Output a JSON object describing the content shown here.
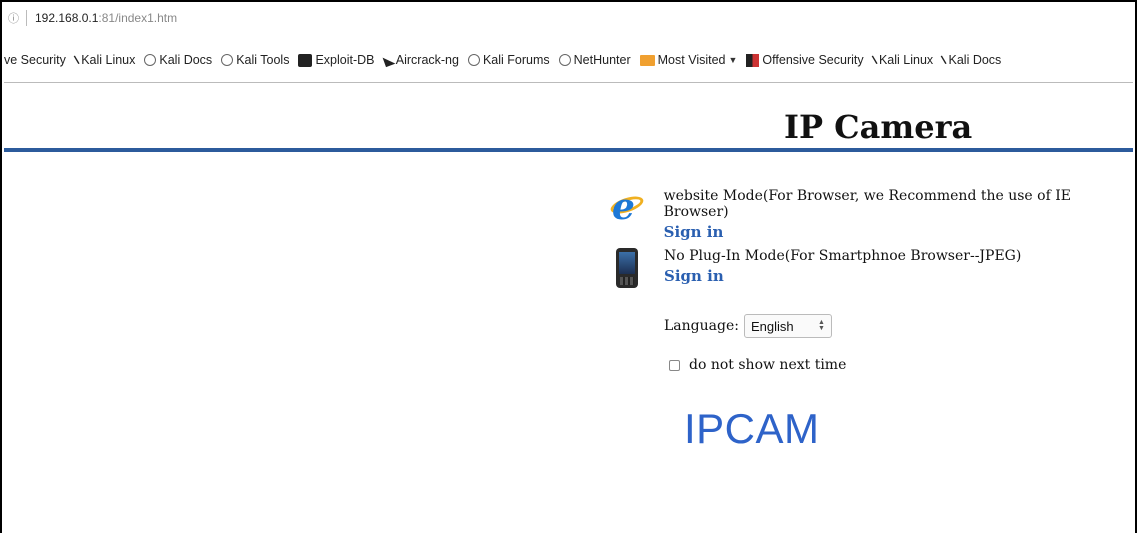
{
  "browser": {
    "url_host": "192.168.0.1",
    "url_rest": ":81/index1.htm",
    "bookmarks": [
      {
        "label": "ve Security",
        "icon": "none"
      },
      {
        "label": "Kali Linux",
        "icon": "kali-dragon-icon"
      },
      {
        "label": "Kali Docs",
        "icon": "globe-icon"
      },
      {
        "label": "Kali Tools",
        "icon": "globe-icon"
      },
      {
        "label": "Exploit-DB",
        "icon": "exploit-db-icon"
      },
      {
        "label": "Aircrack-ng",
        "icon": "aircrack-icon"
      },
      {
        "label": "Kali Forums",
        "icon": "globe-icon"
      },
      {
        "label": "NetHunter",
        "icon": "globe-icon"
      },
      {
        "label": "Most Visited",
        "icon": "folder-icon"
      },
      {
        "label": "Offensive Security",
        "icon": "offsec-icon"
      },
      {
        "label": "Kali Linux",
        "icon": "kali-dragon-icon"
      },
      {
        "label": "Kali Docs",
        "icon": "kali-dragon-icon"
      }
    ]
  },
  "page": {
    "title": "IP Camera",
    "modes": [
      {
        "description": "website Mode(For Browser, we Recommend the use of IE Browser)",
        "signin": "Sign in",
        "icon": "ie-browser-icon"
      },
      {
        "description": "No Plug-In Mode(For Smartphnoe Browser--JPEG)",
        "signin": "Sign in",
        "icon": "smartphone-icon"
      }
    ],
    "language_label": "Language:",
    "language_value": "English",
    "checkbox_label": "do not show next time",
    "logo_text": "IPCAM"
  },
  "colors": {
    "accent_rule": "#2c5b9c",
    "signin_link": "#2a5fb0",
    "logo": "#2e63c9"
  }
}
